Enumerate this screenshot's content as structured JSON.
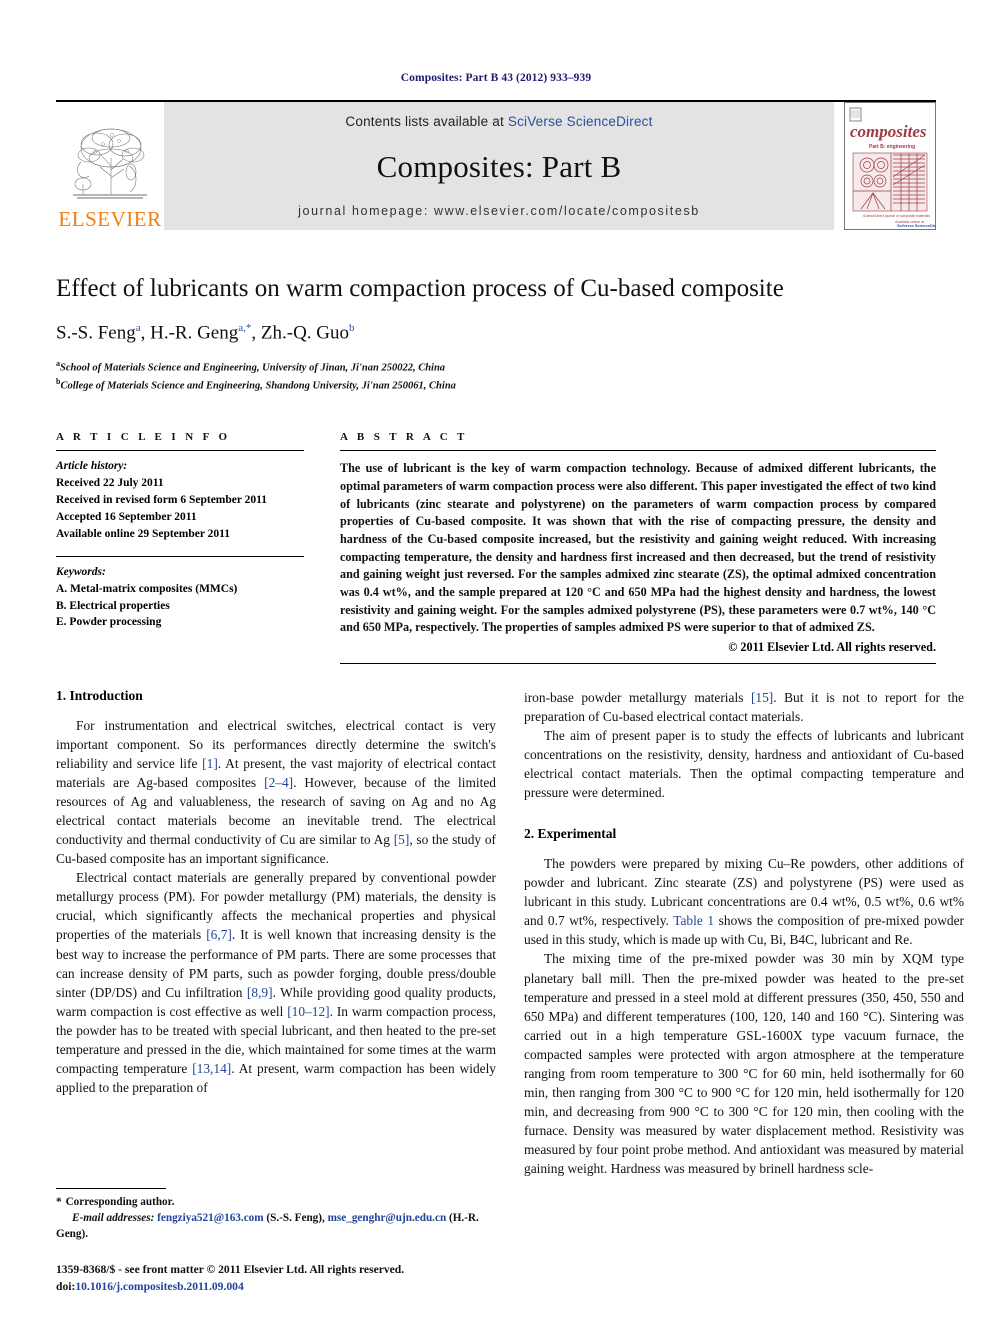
{
  "running_head": "Composites: Part B 43 (2012) 933–939",
  "masthead": {
    "contents_prefix": "Contents lists available at ",
    "contents_link": "SciVerse ScienceDirect",
    "journal_title": "Composites: Part B",
    "homepage": "journal homepage: www.elsevier.com/locate/compositesb",
    "publisher_name": "ELSEVIER",
    "cover_title": "composites",
    "cover_subtitle": "Part B: engineering",
    "accent_orange": "#f07f13",
    "link_blue": "#2b4ea2",
    "band_gray": "#e3e3e3",
    "cover_red": "#9e3b44"
  },
  "article": {
    "title": "Effect of lubricants on warm compaction process of Cu-based composite",
    "authors": [
      {
        "name": "S.-S. Feng",
        "sup": "a"
      },
      {
        "name": "H.-R. Geng",
        "sup": "a,*"
      },
      {
        "name": "Zh.-Q. Guo",
        "sup": "b"
      }
    ],
    "authors_line": "S.-S. Feng a, H.-R. Geng a,*, Zh.-Q. Guo b",
    "affiliations": [
      {
        "sup": "a",
        "text": "School of Materials Science and Engineering, University of Jinan, Ji'nan 250022, China"
      },
      {
        "sup": "b",
        "text": "College of Materials Science and Engineering, Shandong University, Ji'nan 250061, China"
      }
    ]
  },
  "article_info": {
    "heading": "A R T I C L E   I N F O",
    "history_label": "Article history:",
    "history": [
      "Received 22 July 2011",
      "Received in revised form 6 September 2011",
      "Accepted 16 September 2011",
      "Available online 29 September 2011"
    ],
    "keywords_label": "Keywords:",
    "keywords": [
      "A. Metal-matrix composites (MMCs)",
      "B. Electrical properties",
      "E. Powder processing"
    ]
  },
  "abstract": {
    "heading": "A B S T R A C T",
    "text": "The use of lubricant is the key of warm compaction technology. Because of admixed different lubricants, the optimal parameters of warm compaction process were also different. This paper investigated the effect of two kind of lubricants (zinc stearate and polystyrene) on the parameters of warm compaction process by compared properties of Cu-based composite. It was shown that with the rise of compacting pressure, the density and hardness of the Cu-based composite increased, but the resistivity and gaining weight reduced. With increasing compacting temperature, the density and hardness first increased and then decreased, but the trend of resistivity and gaining weight just reversed. For the samples admixed zinc stearate (ZS), the optimal admixed concentration was 0.4 wt%, and the sample prepared at 120 °C and 650 MPa had the highest density and hardness, the lowest resistivity and gaining weight. For the samples admixed polystyrene (PS), these parameters were 0.7 wt%, 140 °C and 650 MPa, respectively. The properties of samples admixed PS were superior to that of admixed ZS.",
    "copyright": "© 2011 Elsevier Ltd. All rights reserved."
  },
  "sections": {
    "intro_heading": "1. Introduction",
    "intro_p1_a": "For instrumentation and electrical switches, electrical contact is very important component. So its performances directly determine the switch's reliability and service life ",
    "intro_p1_r1": "[1]",
    "intro_p1_b": ". At present, the vast majority of electrical contact materials are Ag-based composites ",
    "intro_p1_r2": "[2–4]",
    "intro_p1_c": ". However, because of the limited resources of Ag and valuableness, the research of saving on Ag and no Ag electrical contact materials become an inevitable trend. The electrical conductivity and thermal conductivity of Cu are similar to Ag ",
    "intro_p1_r3": "[5]",
    "intro_p1_d": ", so the study of Cu-based composite has an important significance.",
    "intro_p2_a": "Electrical contact materials are generally prepared by conventional powder metallurgy process (PM). For powder metallurgy (PM) materials, the density is crucial, which significantly affects the mechanical properties and physical properties of the materials ",
    "intro_p2_r1": "[6,7]",
    "intro_p2_b": ". It is well known that increasing density is the best way to increase the performance of PM parts. There are some processes that can increase density of PM parts, such as powder forging, double press/double sinter (DP/DS) and Cu infiltration ",
    "intro_p2_r2": "[8,9]",
    "intro_p2_c": ". While providing good quality products, warm compaction is cost effective as well ",
    "intro_p2_r3": "[10–12]",
    "intro_p2_d": ". In warm compaction process, the powder has to be treated with special lubricant, and then heated to the pre-set temperature and pressed in the die, which maintained for some times at the warm compacting temperature ",
    "intro_p2_r4": "[13,14]",
    "intro_p2_e": ". At present, warm compaction has been widely applied to the preparation of",
    "intro_p2_cont_a": "iron-base powder metallurgy materials ",
    "intro_p2_cont_r": "[15]",
    "intro_p2_cont_b": ". But it is not to report for the preparation of Cu-based electrical contact materials.",
    "intro_p3": "The aim of present paper is to study the effects of lubricants and lubricant concentrations on the resistivity, density, hardness and antioxidant of Cu-based electrical contact materials. Then the optimal compacting temperature and pressure were determined.",
    "exp_heading": "2. Experimental",
    "exp_p1_a": "The powders were prepared by mixing Cu–Re powders, other additions of powder and lubricant. Zinc stearate (ZS) and polystyrene (PS) were used as lubricant in this study. Lubricant concentrations are 0.4 wt%, 0.5 wt%, 0.6 wt% and 0.7 wt%, respectively. ",
    "exp_p1_link": "Table 1",
    "exp_p1_b": " shows the composition of pre-mixed powder used in this study, which is made up with Cu, Bi, B4C, lubricant and Re.",
    "exp_p2": "The mixing time of the pre-mixed powder was 30 min by XQM type planetary ball mill. Then the pre-mixed powder was heated to the pre-set temperature and pressed in a steel mold at different pressures (350, 450, 550 and 650 MPa) and different temperatures (100, 120, 140 and 160 °C). Sintering was carried out in a high temperature GSL-1600X type vacuum furnace, the compacted samples were protected with argon atmosphere at the temperature ranging from room temperature to 300 °C for 60 min, held isothermally for 60 min, then ranging from 300 °C to 900 °C for 120 min, held isothermally for 120 min, and decreasing from 900 °C to 300 °C for 120 min, then cooling with the furnace. Density was measured by water displacement method. Resistivity was measured by four point probe method. And antioxidant was measured by material gaining weight. Hardness was measured by brinell hardness scle-"
  },
  "footnotes": {
    "corresponding": "Corresponding author.",
    "email_label": "E-mail addresses:",
    "email1": "fengziya521@163.com",
    "email1_owner": " (S.-S. Feng), ",
    "email2": "mse_genghr@ujn.edu.cn",
    "email2_owner": " (H.-R. Geng)."
  },
  "imprint": {
    "line1": "1359-8368/$ - see front matter © 2011 Elsevier Ltd. All rights reserved.",
    "doi_label": "doi:",
    "doi_value": "10.1016/j.compositesb.2011.09.004"
  }
}
